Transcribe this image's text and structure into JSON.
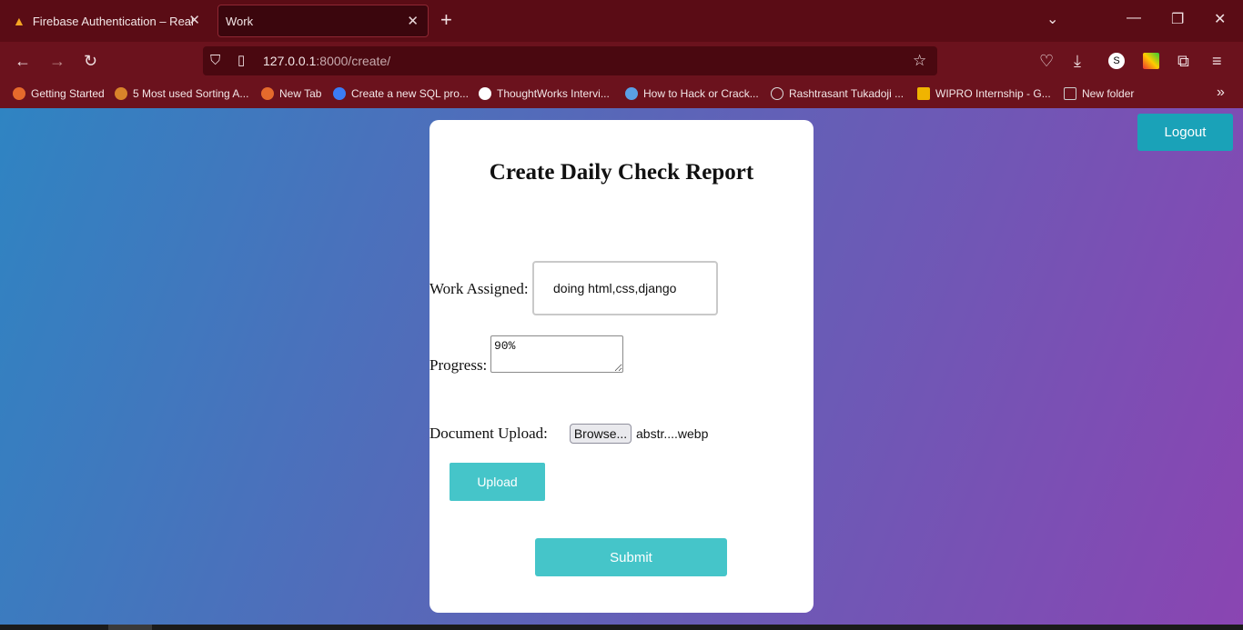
{
  "browser": {
    "tabs": [
      {
        "title": "Firebase Authentication – Realtim",
        "close": "✕"
      },
      {
        "title": "Work",
        "close": "✕"
      }
    ],
    "new_tab": "+",
    "url_host": "127.0.0.1",
    "url_rest": ":8000/create/",
    "bookmarks": [
      {
        "label": "Getting Started",
        "icon_color": "#e66a2c"
      },
      {
        "label": "5 Most used Sorting A...",
        "icon_color": "#d8832a"
      },
      {
        "label": "New Tab",
        "icon_color": "#e66a2c"
      },
      {
        "label": "Create a new SQL pro...",
        "icon_color": "#3b7cf5"
      },
      {
        "label": "ThoughtWorks Intervi...",
        "icon_color": "#ffffff"
      },
      {
        "label": "How to Hack or Crack...",
        "icon_color": "#5aa0e6"
      },
      {
        "label": "Rashtrasant Tukadoji ...",
        "icon_color": "#dddddd"
      },
      {
        "label": "WIPRO Internship - G...",
        "icon_color": "#f0b400"
      },
      {
        "label": "New folder",
        "icon_color": "#cccccc"
      }
    ]
  },
  "page": {
    "logout_label": "Logout",
    "form_title": "Create Daily Check Report",
    "work_label": "Work Assigned:",
    "work_value": "doing html,css,django",
    "progress_label": "Progress:",
    "progress_value": "90%",
    "upload_label": "Document Upload:",
    "browse_label": "Browse...",
    "file_name": "abstr....webp",
    "upload_button": "Upload",
    "submit_button": "Submit"
  },
  "colors": {
    "accent_button": "#45c5c9",
    "logout_button": "#1aa2b8",
    "browser_chrome": "#6b121d"
  }
}
